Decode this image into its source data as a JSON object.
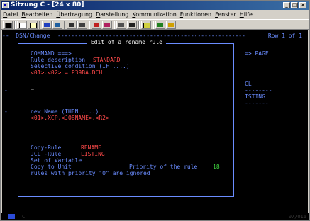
{
  "window": {
    "title": "Sitzung C - [24 x 80]",
    "min": "_",
    "max": "□",
    "close": "×"
  },
  "menu": [
    "Datei",
    "Bearbeiten",
    "Übertragung",
    "Darstellung",
    "Kommunikation",
    "Funktionen",
    "Fenster",
    "Hilfe"
  ],
  "toolbar_icons": [
    "print-screen-icon",
    "copy-icon",
    "paste-icon",
    "send-file-icon",
    "receive-file-icon",
    "display-icon",
    "macro-icon",
    "record-icon",
    "play-icon",
    "keypad-icon",
    "color-icon",
    "help-icon",
    "stop-icon"
  ],
  "screen": {
    "header_left": "--  DSN/Change ",
    "header_dashes": "-------------------------------------------------------",
    "header_right": " Row 1 of 1",
    "popup_title": " Edit of a rename rule ",
    "command_label": "COMMAND ===>",
    "rule_description_label": "Rule description",
    "rule_description_value": "STANDARD",
    "selective_condition_label": "Selective condition (IF ....)",
    "condition_value": "<01>.<02> = P39BA.DCH",
    "cursor": "_",
    "new_name_label": "new Name (THEN ....)",
    "new_name_value": "<01>.XCP.<JOBNAME>.<R2>",
    "copy_rule_label": "Copy-Rule",
    "copy_rule_value": "RENAME",
    "jcl_rule_label": "JCL -Rule",
    "jcl_rule_value": "LISTING",
    "set_variable_label": "Set of Variable",
    "copy_unit_label": "Copy to Unit",
    "priority_label": "Priority of the rule",
    "priority_value": "18",
    "ignore_note": "rules with priority \"0\" are ignored",
    "right_page": "=> PAGE",
    "right_cl": "CL",
    "right_dashes1": "--------",
    "right_listing": "ISTING",
    "right_dashes2": "-------",
    "left_dash1": "-",
    "left_dash2": "-"
  },
  "status": {
    "indicator": "MA",
    "session": "C",
    "cursor_pos": "07/016"
  }
}
